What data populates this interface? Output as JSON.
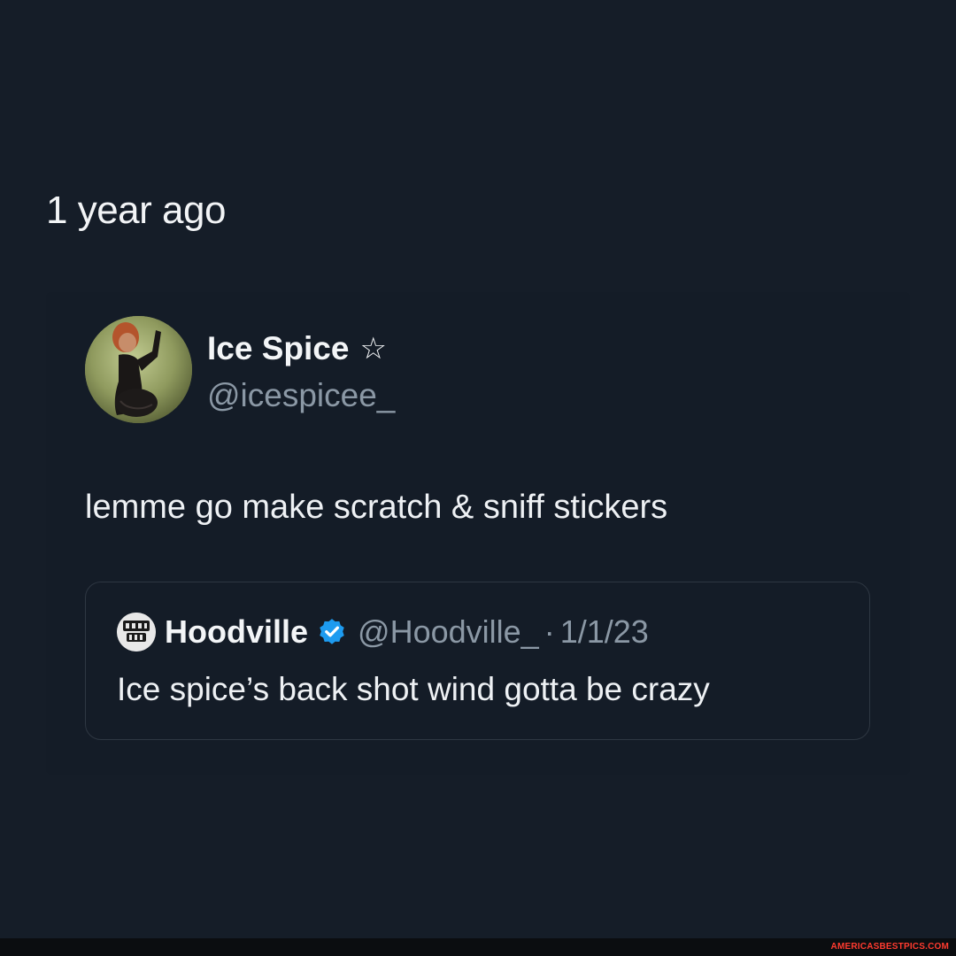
{
  "post": {
    "time_ago": "1 year ago",
    "author": {
      "display_name": "Ice Spice",
      "badge_icon": "star-outline-icon",
      "badge_glyph": "☆",
      "handle": "@icespicee_"
    },
    "text": "lemme go make scratch & sniff stickers"
  },
  "quoted_post": {
    "author": {
      "display_name": "Hoodville",
      "verified": true,
      "verified_icon": "verified-badge-icon",
      "verified_color": "#1d9bf0",
      "handle": "@Hoodville_",
      "separator": "·",
      "date": "1/1/23"
    },
    "text": "Ice spice’s back shot wind gotta be crazy"
  },
  "watermark": {
    "text": "AMERICASBESTPICS.COM",
    "color": "#ff3b2f"
  },
  "colors": {
    "background": "#151d28",
    "secondary_text": "#8b98a5"
  }
}
